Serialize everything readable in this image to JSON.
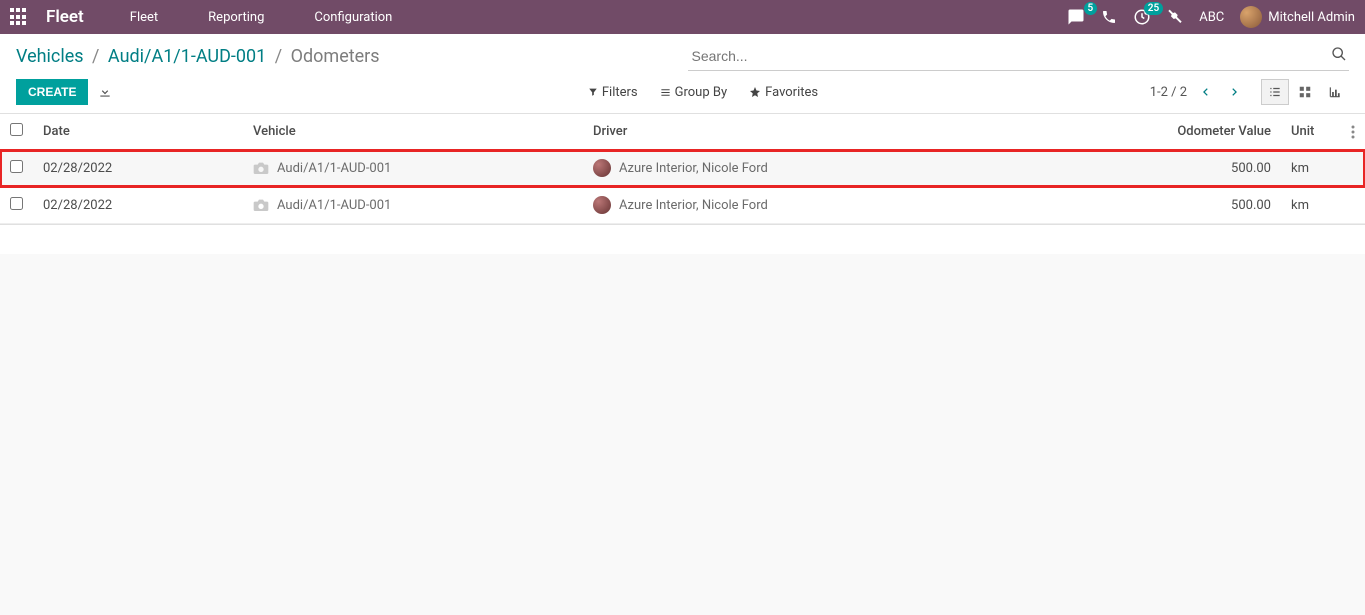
{
  "navbar": {
    "brand": "Fleet",
    "links": [
      "Fleet",
      "Reporting",
      "Configuration"
    ],
    "chat_badge": "5",
    "clock_badge": "25",
    "company": "ABC",
    "user": "Mitchell Admin"
  },
  "breadcrumb": {
    "parts": [
      "Vehicles",
      "Audi/A1/1-AUD-001"
    ],
    "current": "Odometers"
  },
  "search": {
    "placeholder": "Search..."
  },
  "toolbar": {
    "create": "CREATE",
    "filters": "Filters",
    "groupby": "Group By",
    "favorites": "Favorites"
  },
  "pager": {
    "range": "1-2 / 2"
  },
  "columns": {
    "date": "Date",
    "vehicle": "Vehicle",
    "driver": "Driver",
    "value": "Odometer Value",
    "unit": "Unit"
  },
  "rows": [
    {
      "date": "02/28/2022",
      "vehicle": "Audi/A1/1-AUD-001",
      "driver": "Azure Interior, Nicole Ford",
      "value": "500.00",
      "unit": "km",
      "highlight": true
    },
    {
      "date": "02/28/2022",
      "vehicle": "Audi/A1/1-AUD-001",
      "driver": "Azure Interior, Nicole Ford",
      "value": "500.00",
      "unit": "km",
      "highlight": false
    }
  ]
}
